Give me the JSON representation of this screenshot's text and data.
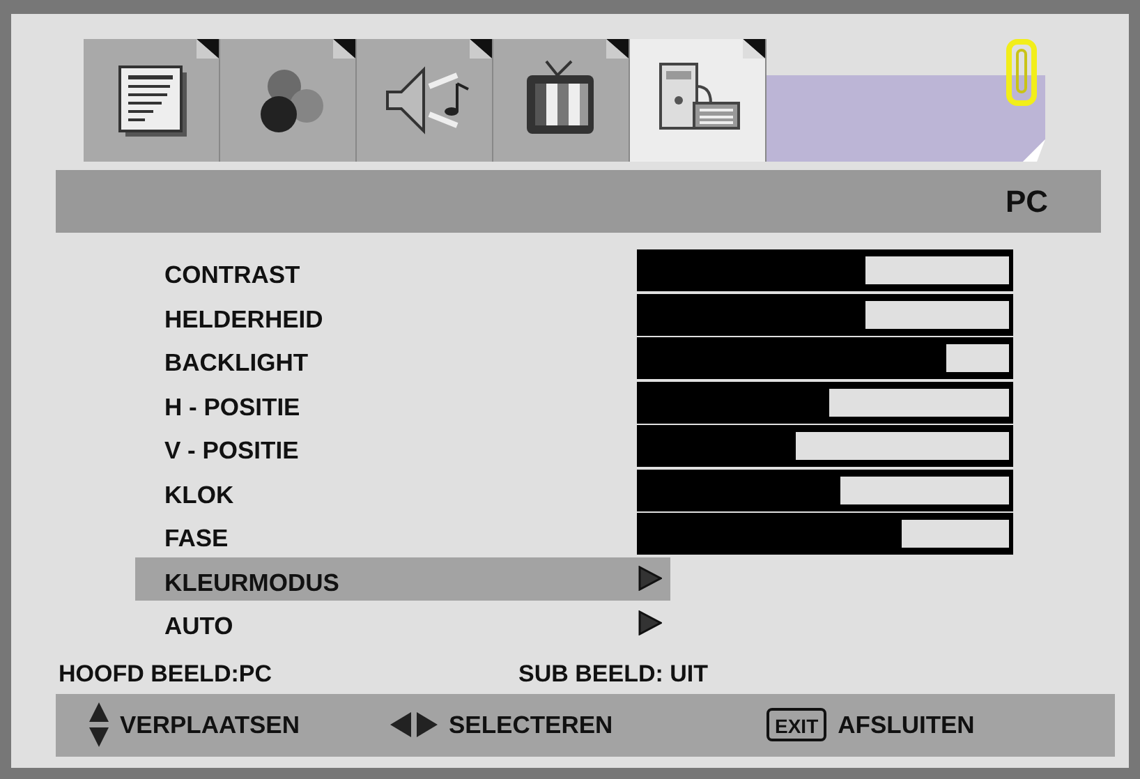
{
  "tabs": [
    {
      "kind": "document",
      "selected": false
    },
    {
      "kind": "colors",
      "selected": false
    },
    {
      "kind": "sound",
      "selected": false
    },
    {
      "kind": "tv",
      "selected": false
    },
    {
      "kind": "pc",
      "selected": true
    }
  ],
  "header": {
    "title": "PC"
  },
  "items": [
    {
      "label": "CONTRAST",
      "kind": "slider",
      "level": 0.61,
      "selected": false
    },
    {
      "label": "HELDERHEID",
      "kind": "slider",
      "level": 0.61,
      "selected": false
    },
    {
      "label": "BACKLIGHT",
      "kind": "slider",
      "level": 0.83,
      "selected": false
    },
    {
      "label": "H - POSITIE",
      "kind": "slider",
      "level": 0.51,
      "selected": false
    },
    {
      "label": "V - POSITIE",
      "kind": "slider",
      "level": 0.42,
      "selected": false
    },
    {
      "label": "KLOK",
      "kind": "slider",
      "level": 0.54,
      "selected": false
    },
    {
      "label": "FASE",
      "kind": "slider",
      "level": 0.71,
      "selected": false
    },
    {
      "label": "KLEURMODUS",
      "kind": "submenu",
      "selected": true
    },
    {
      "label": "AUTO",
      "kind": "submenu",
      "selected": false
    }
  ],
  "status": {
    "main": "HOOFD BEELD:PC",
    "sub": "SUB BEELD: UIT"
  },
  "hints": [
    {
      "kind": "updown",
      "label": "VERPLAATSEN"
    },
    {
      "kind": "leftright",
      "label": "SELECTEREN"
    },
    {
      "kind": "key",
      "key": "EXIT",
      "label": "AFSLUITEN"
    }
  ]
}
